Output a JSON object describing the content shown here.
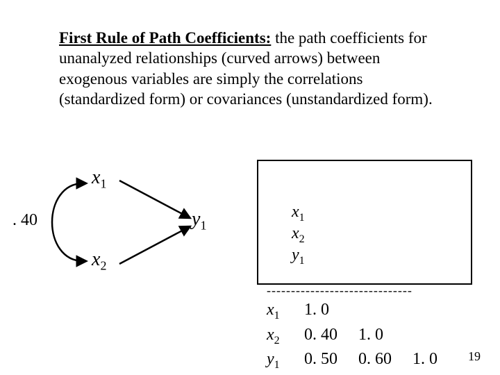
{
  "heading": {
    "title": "First Rule of Path Coefficients:",
    "body": " the path coefficients for unanalyzed relationships (curved arrows) between exogenous variables are simply the correlations (standardized form) or covariances (unstandardized form)."
  },
  "diagram": {
    "x1": "x",
    "x1_sub": "1",
    "x2": "x",
    "x2_sub": "2",
    "y1": "y",
    "y1_sub": "1",
    "coef": ". 40"
  },
  "table": {
    "h1": "x",
    "h1_sub": "1",
    "h2": "x",
    "h2_sub": "2",
    "h3": "y",
    "h3_sub": "1",
    "dash": "------------------------------",
    "r1_label": "x",
    "r1_sub": "1",
    "r1_c1": "1. 0",
    "r2_label": "x",
    "r2_sub": "2",
    "r2_c1": "0. 40",
    "r2_c2": "1. 0",
    "r3_label": "y",
    "r3_sub": "1",
    "r3_c1": "0. 50",
    "r3_c2": "0. 60",
    "r3_c3": "1. 0"
  },
  "page_number": "19"
}
